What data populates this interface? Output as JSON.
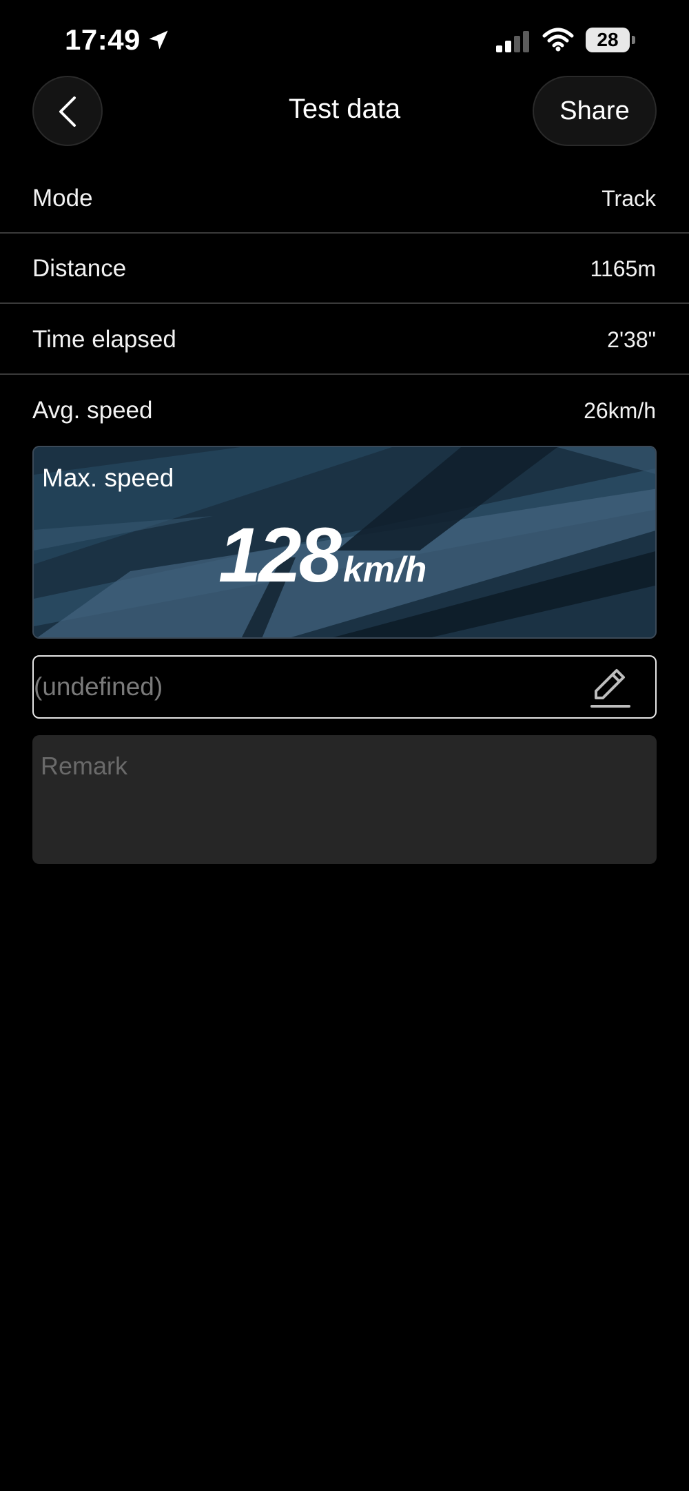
{
  "status_bar": {
    "time": "17:49",
    "battery_level": "28",
    "icons": [
      "location-arrow-icon",
      "signal-icon",
      "wifi-icon",
      "battery-icon"
    ]
  },
  "nav": {
    "title": "Test data",
    "share_label": "Share",
    "back_icon": "chevron-left-icon"
  },
  "details": {
    "rows": [
      {
        "label": "Mode",
        "value": "Track"
      },
      {
        "label": "Distance",
        "value": "1165m"
      },
      {
        "label": "Time elapsed",
        "value": "2'38\""
      },
      {
        "label": "Avg. speed",
        "value": "26km/h"
      }
    ]
  },
  "max_speed": {
    "label": "Max. speed",
    "value": "128",
    "unit": "km/h"
  },
  "name_field": {
    "value": "(undefined)",
    "edit_icon": "pencil-icon"
  },
  "remark": {
    "placeholder": "Remark"
  },
  "colors": {
    "background": "#000000",
    "card_base": "#1b3244",
    "input_border": "#e6e6e6",
    "remark_bg": "#262626",
    "placeholder": "#6a6a6a"
  }
}
